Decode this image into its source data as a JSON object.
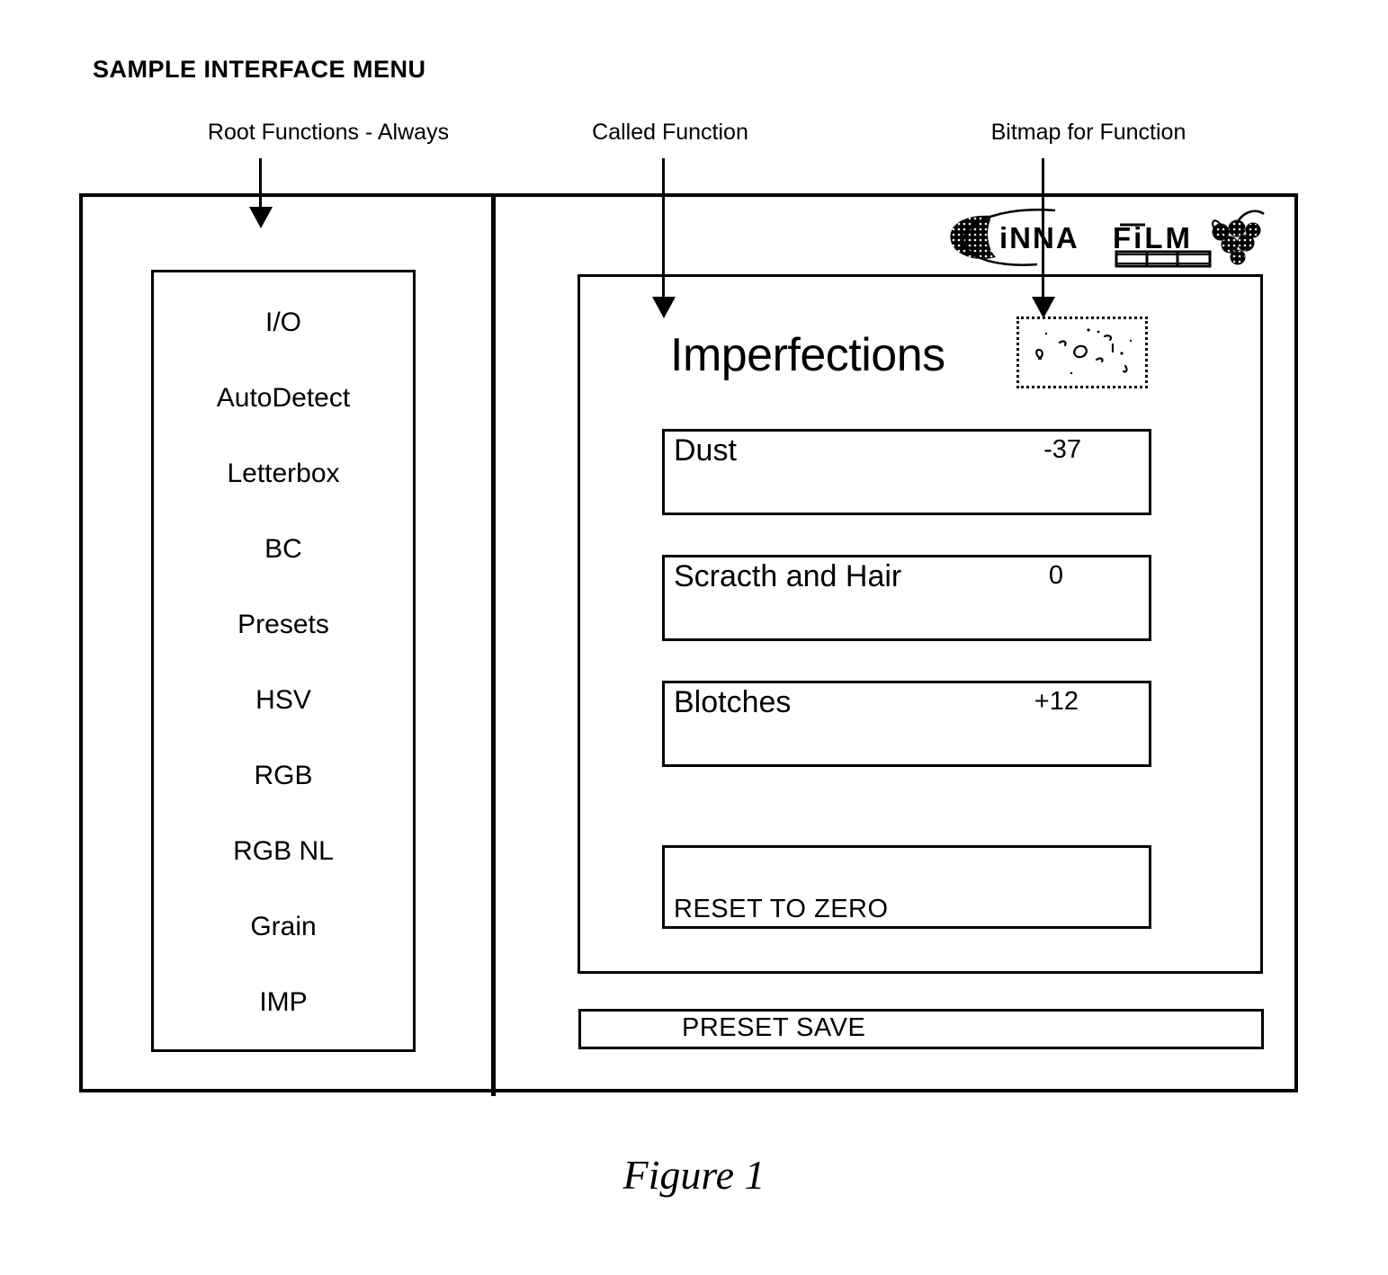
{
  "sheet": {
    "title": "SAMPLE INTERFACE MENU",
    "figure_caption": "Figure 1"
  },
  "annotations": [
    {
      "id": "root-functions",
      "label": "Root Functions - Always"
    },
    {
      "id": "called-function",
      "label": "Called Function"
    },
    {
      "id": "bitmap-for-function",
      "label": "Bitmap for Function"
    }
  ],
  "sidebar": {
    "items": [
      {
        "label": "I/O"
      },
      {
        "label": "AutoDetect"
      },
      {
        "label": "Letterbox"
      },
      {
        "label": "BC"
      },
      {
        "label": "Presets"
      },
      {
        "label": "HSV"
      },
      {
        "label": "RGB"
      },
      {
        "label": "RGB NL"
      },
      {
        "label": "Grain"
      },
      {
        "label": "IMP"
      }
    ]
  },
  "function_panel": {
    "title": "Imperfections",
    "bitmap_preview_name": "imperfections-bitmap",
    "parameters": [
      {
        "label": "Dust",
        "value": "-37"
      },
      {
        "label": "Scracth and Hair",
        "value": "0"
      },
      {
        "label": "Blotches",
        "value": "+12"
      }
    ],
    "reset_button_label": "RESET TO ZERO"
  },
  "preset_save": {
    "label": "PRESET SAVE"
  },
  "brand": {
    "name": "CINNAFILM",
    "wordmark": "iNNA FiLM"
  },
  "colors": {
    "ink": "#000000",
    "paper": "#ffffff"
  }
}
